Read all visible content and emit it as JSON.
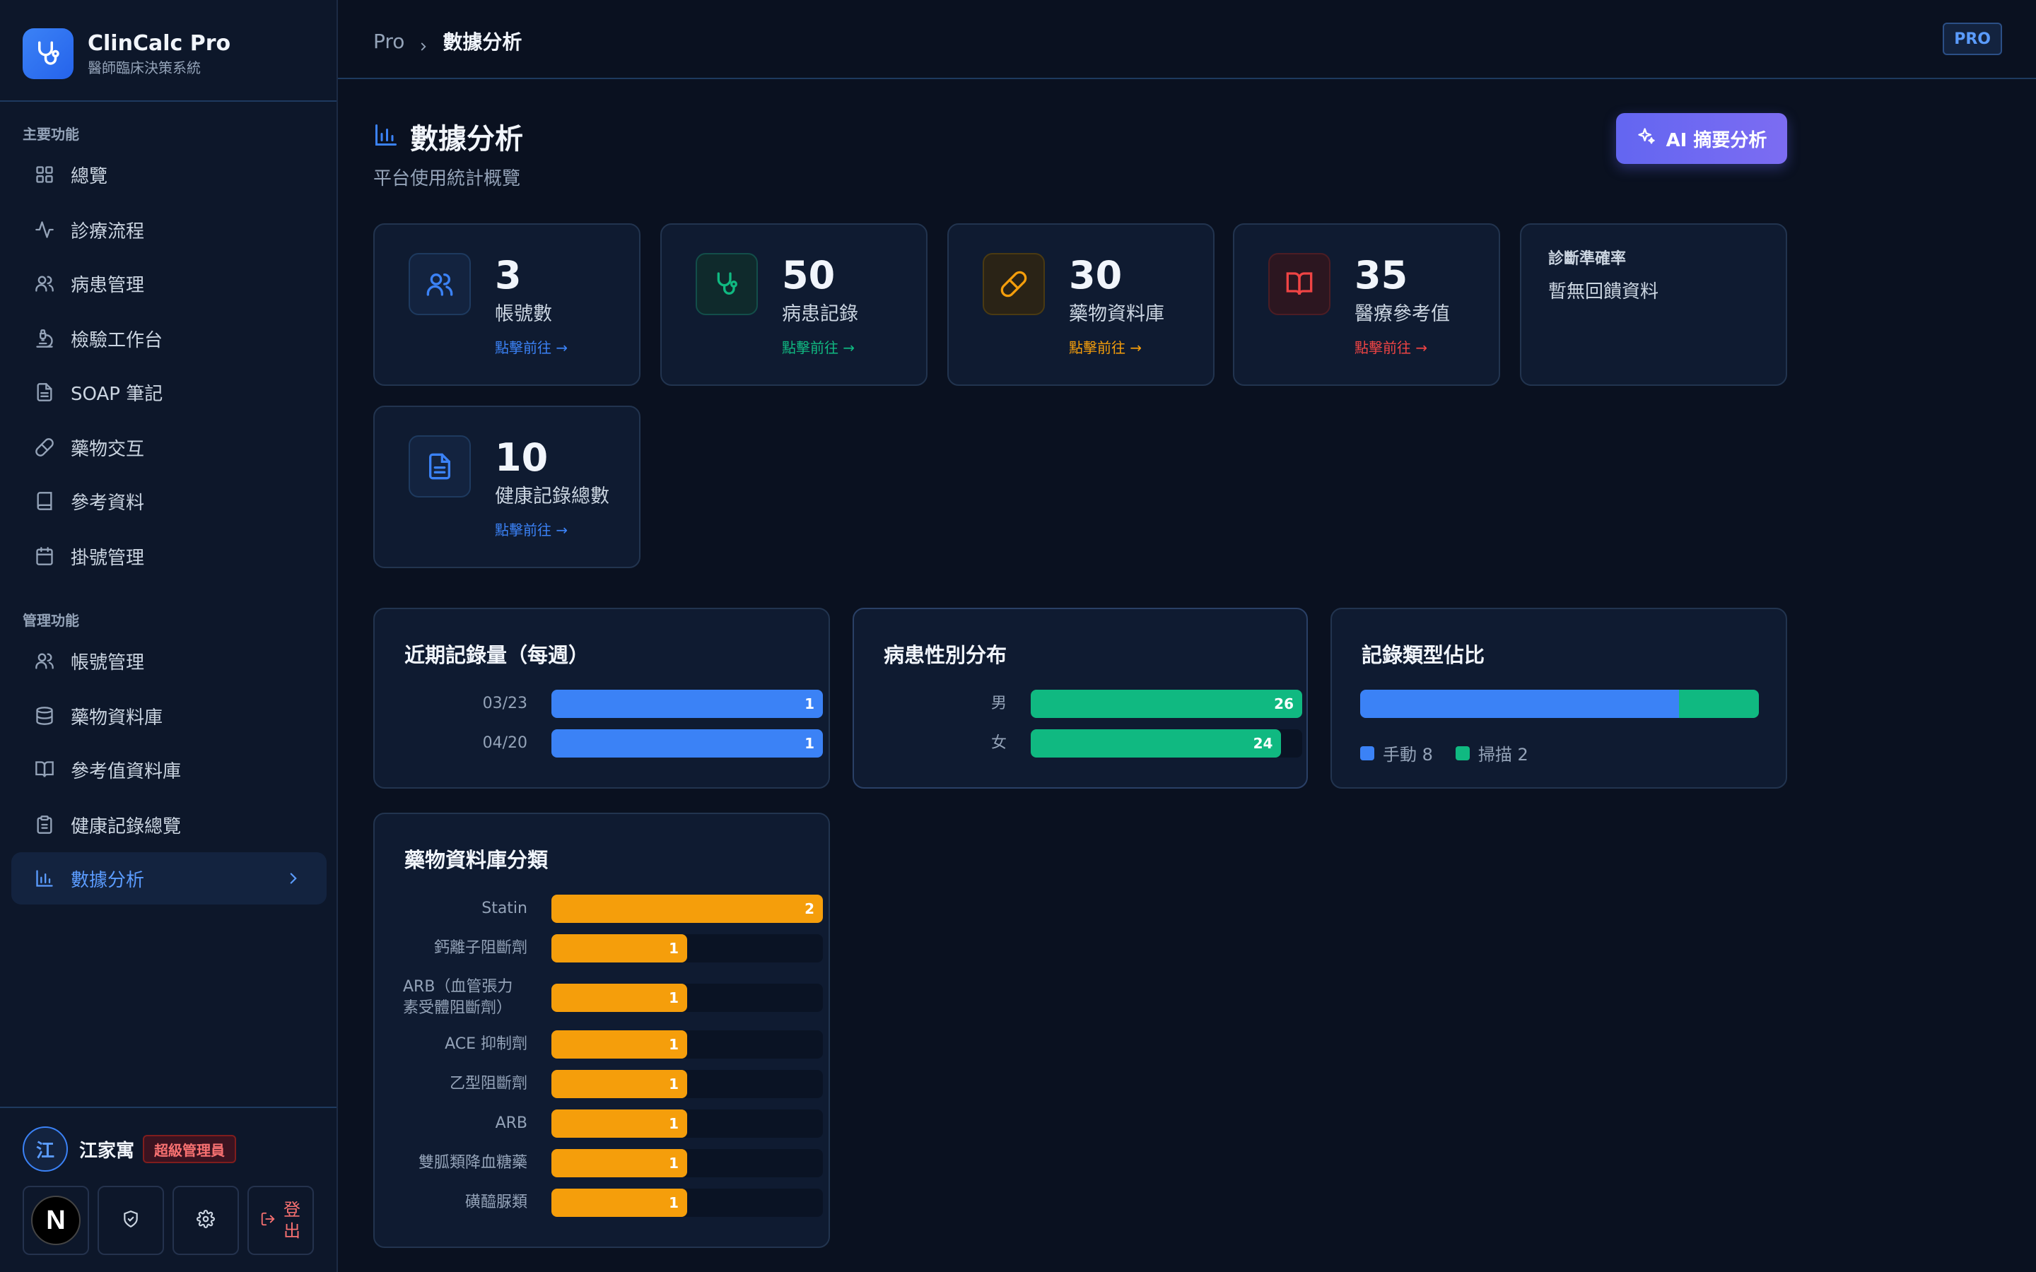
{
  "brand": {
    "name": "ClinCalc Pro",
    "subtitle": "醫師臨床決策系統"
  },
  "sidebar": {
    "section_main": "主要功能",
    "main_items": [
      {
        "label": "總覽",
        "icon": "grid-icon"
      },
      {
        "label": "診療流程",
        "icon": "activity-icon"
      },
      {
        "label": "病患管理",
        "icon": "users-icon"
      },
      {
        "label": "檢驗工作台",
        "icon": "microscope-icon"
      },
      {
        "label": "SOAP 筆記",
        "icon": "file-text-icon"
      },
      {
        "label": "藥物交互",
        "icon": "pill-icon"
      },
      {
        "label": "參考資料",
        "icon": "book-icon"
      },
      {
        "label": "掛號管理",
        "icon": "calendar-icon"
      }
    ],
    "section_admin": "管理功能",
    "admin_items": [
      {
        "label": "帳號管理",
        "icon": "users-icon"
      },
      {
        "label": "藥物資料庫",
        "icon": "database-icon"
      },
      {
        "label": "參考值資料庫",
        "icon": "book-open-icon"
      },
      {
        "label": "健康記錄總覽",
        "icon": "clipboard-icon"
      },
      {
        "label": "數據分析",
        "icon": "bar-chart-icon",
        "active": true
      }
    ]
  },
  "user": {
    "avatar_initial": "江",
    "name": "江家寓",
    "role": "超級管理員",
    "logout_label": "登出"
  },
  "topbar": {
    "breadcrumb_root": "Pro",
    "breadcrumb_current": "數據分析",
    "badge": "PRO"
  },
  "page": {
    "title": "數據分析",
    "subtitle": "平台使用統計概覽",
    "ai_button": "AI 摘要分析"
  },
  "stats": [
    {
      "value": "3",
      "label": "帳號數",
      "link": "點擊前往 →",
      "color": "#3b82f6",
      "icon": "users-icon"
    },
    {
      "value": "50",
      "label": "病患記錄",
      "link": "點擊前往 →",
      "color": "#10b981",
      "icon": "stethoscope-icon"
    },
    {
      "value": "30",
      "label": "藥物資料庫",
      "link": "點擊前往 →",
      "color": "#f59e0b",
      "icon": "pill-icon"
    },
    {
      "value": "35",
      "label": "醫療參考值",
      "link": "點擊前往 →",
      "color": "#ef4444",
      "icon": "book-open-icon"
    },
    {
      "value": "10",
      "label": "健康記錄總數",
      "link": "點擊前往 →",
      "color": "#3b82f6",
      "icon": "file-text-icon"
    }
  ],
  "accuracy": {
    "title": "診斷準確率",
    "value": "暫無回饋資料"
  },
  "colors": {
    "blue": "#3b82f6",
    "green": "#10b981",
    "orange": "#f59e0b",
    "red": "#ef4444",
    "accent": "#6366f1"
  },
  "chart_data": [
    {
      "type": "bar",
      "title": "近期記錄量（每週）",
      "categories": [
        "03/23",
        "04/20"
      ],
      "values": [
        1,
        1
      ],
      "max": 1,
      "color": "#3b82f6"
    },
    {
      "type": "bar",
      "title": "病患性別分布",
      "categories": [
        "男",
        "女"
      ],
      "values": [
        26,
        24
      ],
      "max": 26,
      "color": "#10b981"
    },
    {
      "type": "bar",
      "title": "記錄類型佔比",
      "categories": [
        "手動",
        "掃描"
      ],
      "values": [
        8,
        2
      ],
      "colors": [
        "#3b82f6",
        "#10b981"
      ]
    },
    {
      "type": "bar",
      "title": "藥物資料庫分類",
      "categories": [
        "Statin",
        "鈣離子阻斷劑",
        "ARB（血管張力素受體阻斷劑）",
        "ACE 抑制劑",
        "乙型阻斷劑",
        "ARB",
        "雙胍類降血糖藥",
        "磺醯脲類"
      ],
      "values": [
        2,
        1,
        1,
        1,
        1,
        1,
        1,
        1
      ],
      "max": 2,
      "color": "#f59e0b"
    }
  ]
}
